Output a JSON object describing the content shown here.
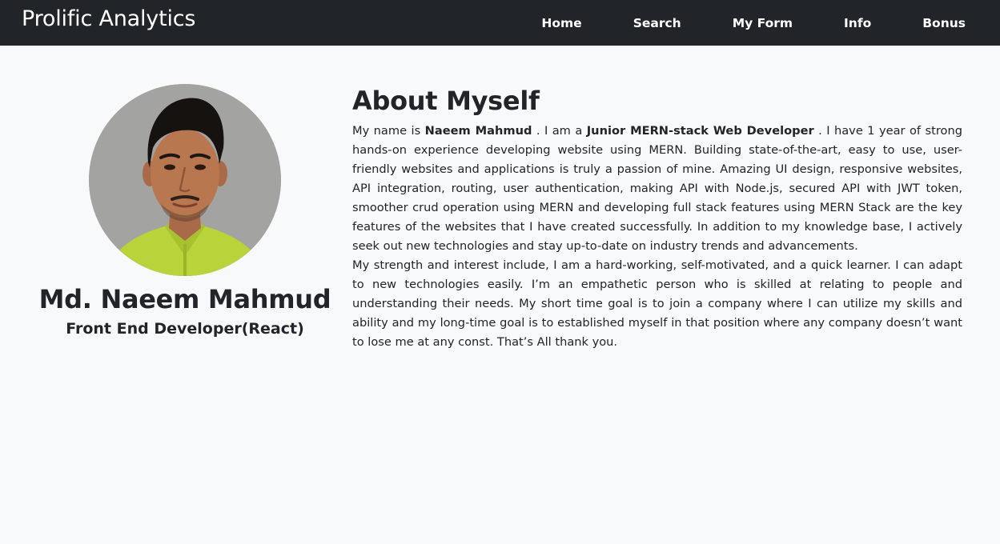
{
  "nav": {
    "brand": "Prolific Analytics",
    "links": [
      "Home",
      "Search",
      "My Form",
      "Info",
      "Bonus"
    ]
  },
  "profile": {
    "name": "Md. Naeem Mahmud",
    "role": "Front End Developer(React)",
    "avatar_icon": "profile-photo"
  },
  "about": {
    "title": "About Myself",
    "p1_intro": "My name is ",
    "p1_name": "Naeem Mahmud",
    "p1_mid": " . I am a ",
    "p1_title": "Junior MERN-stack Web Developer",
    "p1_rest": " . I have 1 year of strong hands-on experience developing website using MERN. Building state-of-the-art, easy to use, user-friendly websites and applications is truly a passion of mine. Amazing UI design, responsive websites, API integration, routing, user authentication, making API with Node.js, secured API with JWT token, smoother crud operation using MERN and developing full stack features using MERN Stack are the key features of the websites that I have created successfully. In addition to my knowledge base, I actively seek out new technologies and stay up-to-date on industry trends and advancements.",
    "p2": "My strength and interest include, I am a hard-working, self-motivated, and a quick learner. I can adapt to new technologies easily. I’m an empathetic person who is skilled at relating to people and understanding their needs. My short time goal is to join a company where I can utilize my skills and ability and my long-time goal is to established myself in that position where any company doesn’t want to lose me at any const. That’s All thank you."
  },
  "colors": {
    "navbar_bg": "#212529",
    "page_bg": "#f8f9fa",
    "text": "#212529"
  }
}
